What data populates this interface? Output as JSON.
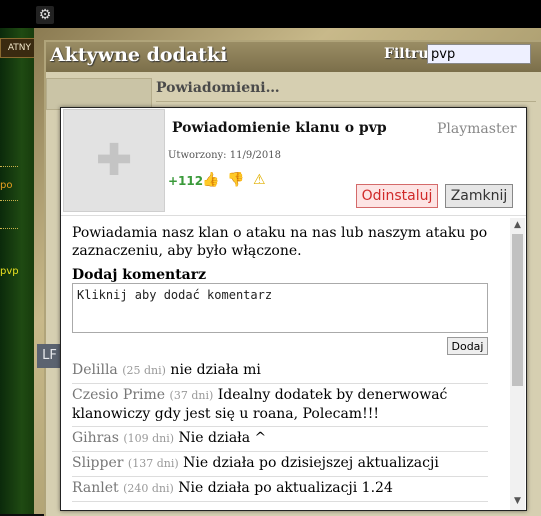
{
  "topbar": {
    "gear_icon": "gear-icon"
  },
  "left_column": {
    "tab_label": "ATNY",
    "items": [
      "po",
      "pvp"
    ],
    "lf_label": "LF"
  },
  "panel": {
    "title": "Aktywne dodatki",
    "filter_label": "Filtruj",
    "filter_value": "pvp",
    "background_card_title": "Powiadomieni…"
  },
  "modal": {
    "title": "Powiadomienie klanu o pvp",
    "author": "Playmaster",
    "created": "Utworzony: 11/9/2018",
    "score": "+112",
    "icons": [
      "thumbs-up-icon",
      "thumbs-down-icon",
      "warning-icon"
    ],
    "uninstall_label": "Odinstaluj",
    "close_label": "Zamknij",
    "description": "Powiadamia nasz klan o ataku na nas lub naszym ataku po zaznaczeniu, aby było włączone.",
    "add_comment_heading": "Dodaj komentarz",
    "comment_placeholder": "Kliknij aby dodać komentarz",
    "add_button_label": "Dodaj",
    "comments": [
      {
        "author": "Delilla",
        "age": "(25 dni)",
        "text": "nie działa mi"
      },
      {
        "author": "Czesio Prime",
        "age": "(37 dni)",
        "text": "Idealny dodatek by denerwować klanowiczy gdy jest się u roana, Polecam!!!"
      },
      {
        "author": "Gihras",
        "age": "(109 dni)",
        "text": "Nie działa ^"
      },
      {
        "author": "Slipper",
        "age": "(137 dni)",
        "text": "Nie działa po dzisiejszej aktualizacji"
      },
      {
        "author": "Ranlet",
        "age": "(240 dni)",
        "text": "Nie działa po aktualizacji 1.24"
      }
    ]
  },
  "colors": {
    "score_green": "#3a9a3a",
    "uninstall_red": "#d02a2a",
    "header_brown": "#8a7d55"
  }
}
